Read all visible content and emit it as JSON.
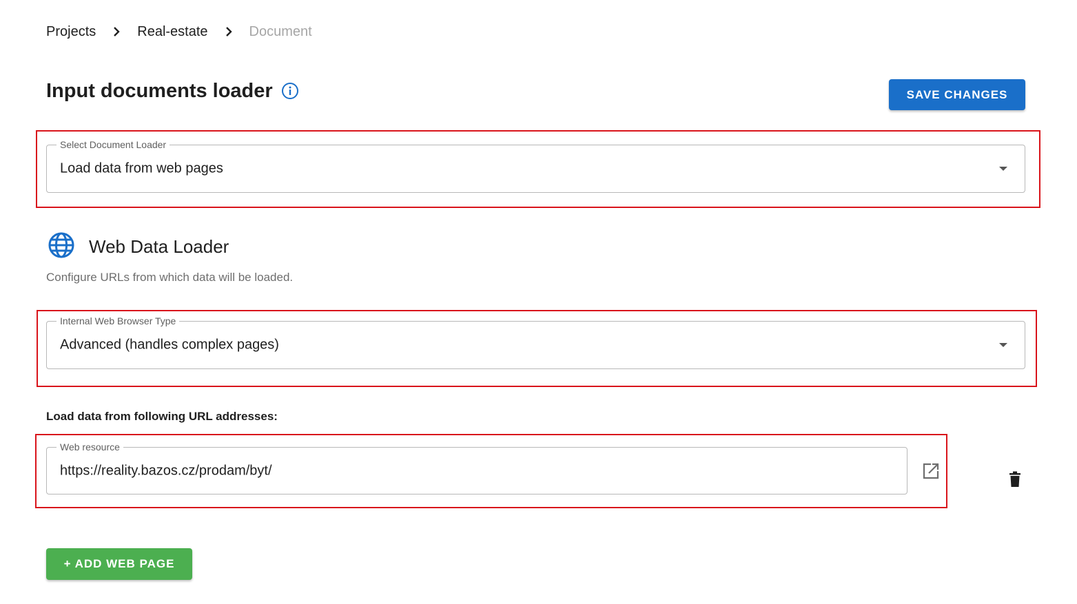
{
  "breadcrumb": {
    "items": [
      "Projects",
      "Real-estate",
      "Document"
    ]
  },
  "header": {
    "title": "Input documents loader",
    "info_icon": "info-circle-icon",
    "save_label": "SAVE CHANGES"
  },
  "loader_select": {
    "label": "Select Document Loader",
    "value": "Load data from web pages"
  },
  "web_loader": {
    "icon": "globe-icon",
    "title": "Web Data Loader",
    "description": "Configure URLs from which data will be loaded."
  },
  "browser_select": {
    "label": "Internal Web Browser Type",
    "value": "Advanced (handles complex pages)"
  },
  "urls": {
    "heading": "Load data from following URL addresses:",
    "items": [
      {
        "label": "Web resource",
        "value": "https://reality.bazos.cz/prodam/byt/"
      }
    ],
    "add_label": "+ ADD WEB PAGE"
  },
  "colors": {
    "primary": "#1a6fc9",
    "success": "#4caf50",
    "highlight": "#d9141b",
    "muted_text": "#a6a6a6"
  }
}
